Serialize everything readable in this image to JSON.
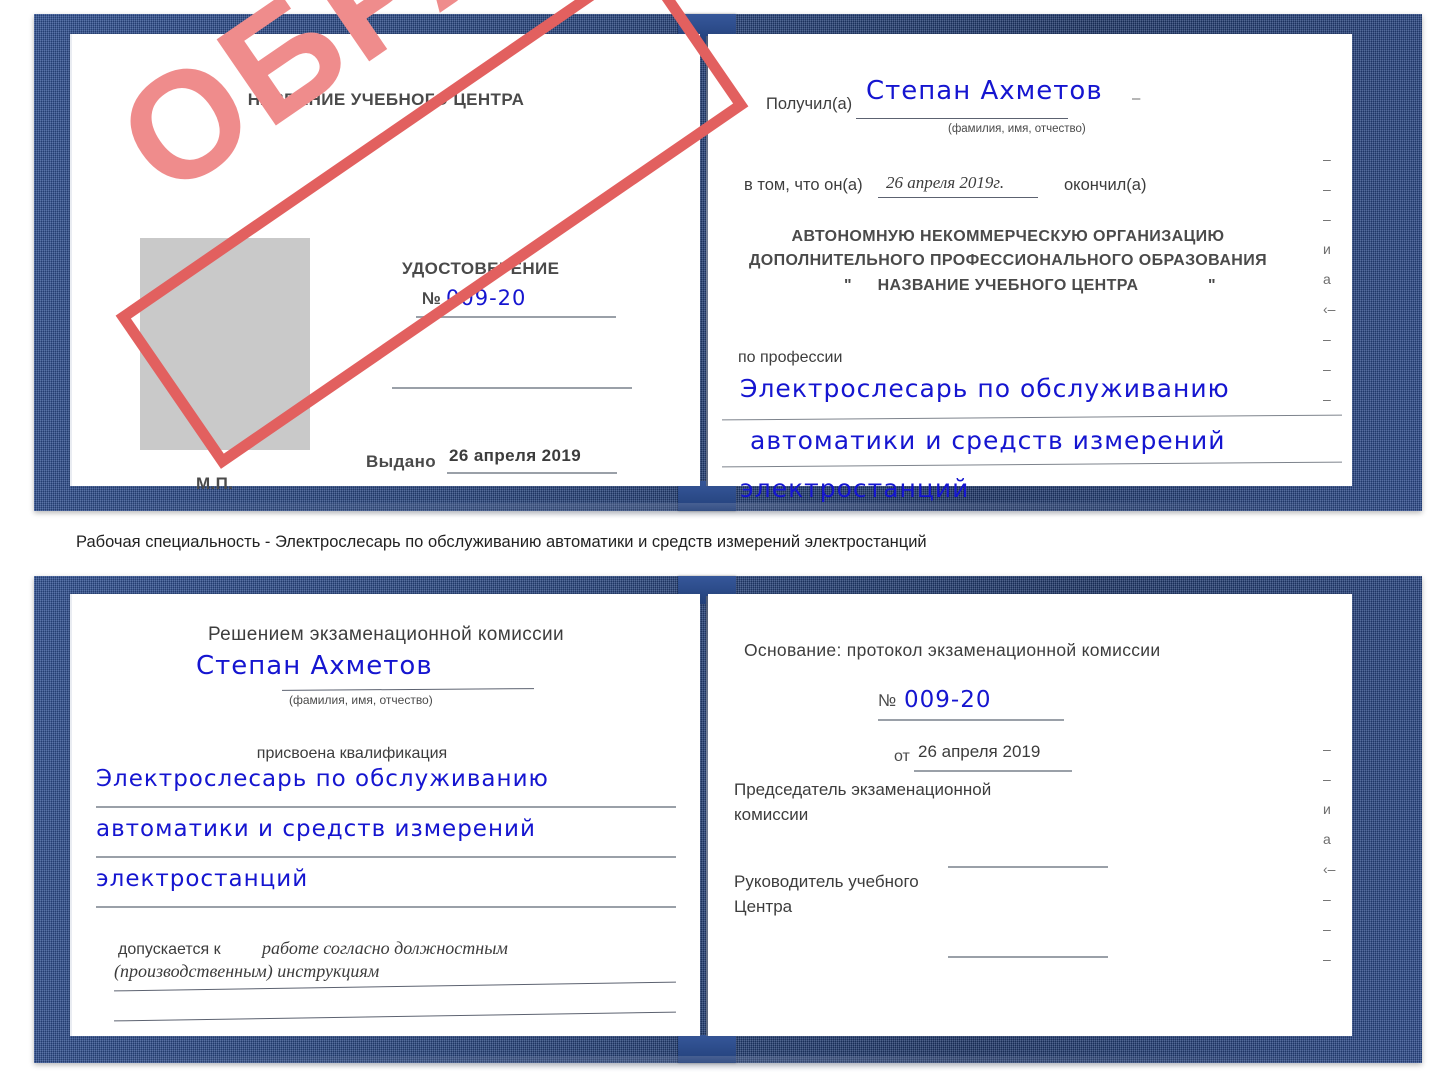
{
  "document": {
    "kind": "udostoverenie-certificate-sample",
    "stamp_label": "ОБРАЗЕЦ",
    "colors": {
      "cover_blue": "#27457f",
      "stamp_border_red": "#e2605f",
      "stamp_text_red": "#ef8c8c",
      "handwriting_blue": "#1515d0",
      "photo_placeholder_gray": "#c9c9c9",
      "rule_gray": "#9aa0a8"
    }
  },
  "caption": {
    "text": "Рабочая специальность - Электрослесарь по обслуживанию автоматики и средств измерений электростанций"
  },
  "certificate_top": {
    "left_page": {
      "center_title": "НАЗВАНИЕ УЧЕБНОГО ЦЕНТРА",
      "doc_title": "УДОСТОВЕРЕНИЕ",
      "number_label": "№",
      "number_value": "009-20",
      "issued_label": "Выдано",
      "issued_value": "26 апреля 2019",
      "seal_label": "М.П.",
      "photo_placeholder": "photo-area"
    },
    "right_page": {
      "received_label": "Получил(а)",
      "received_value": "Степан Ахметов",
      "fio_hint": "(фамилия, имя, отчество)",
      "that_he_label": "в том, что он(а)",
      "completion_date": "26 апреля 2019г.",
      "finished_label": "окончил(а)",
      "org_line1": "АВТОНОМНУЮ НЕКОММЕРЧЕСКУЮ ОРГАНИЗАЦИЮ",
      "org_line2": "ДОПОЛНИТЕЛЬНОГО ПРОФЕССИОНАЛЬНОГО ОБРАЗОВАНИЯ",
      "org_quote_open": "\"",
      "org_name": "НАЗВАНИЕ УЧЕБНОГО ЦЕНТРА",
      "org_quote_close": "\"",
      "profession_label": "по профессии",
      "profession_line1": "Электрослесарь по обслуживанию",
      "profession_line2": "автоматики и средств измерений",
      "profession_line3": "электростанций",
      "edge_fragments": "–\n–\n–\nи\nа\n‹–\n–\n–\n–"
    }
  },
  "certificate_bottom": {
    "left_page": {
      "decision_title": "Решением экзаменационной комиссии",
      "name_value": "Степан Ахметов",
      "fio_hint": "(фамилия, имя, отчество)",
      "qualification_label": "присвоена квалификация",
      "qualification_line1": "Электрослесарь по обслуживанию",
      "qualification_line2": "автоматики и средств измерений",
      "qualification_line3": "электростанций",
      "admitted_label": "допускается к",
      "admitted_value_line1": "работе согласно должностным",
      "admitted_value_line2": "(производственным) инструкциям"
    },
    "right_page": {
      "basis_label": "Основание: протокол экзаменационной комиссии",
      "number_label": "№",
      "number_value": "009-20",
      "date_label": "от",
      "date_value": "26 апреля 2019",
      "chairman_line1": "Председатель экзаменационной",
      "chairman_line2": "комиссии",
      "head_line1": "Руководитель учебного",
      "head_line2": "Центра",
      "edge_fragments": "–\n–\nи\nа\n‹–\n–\n–\n–"
    }
  }
}
